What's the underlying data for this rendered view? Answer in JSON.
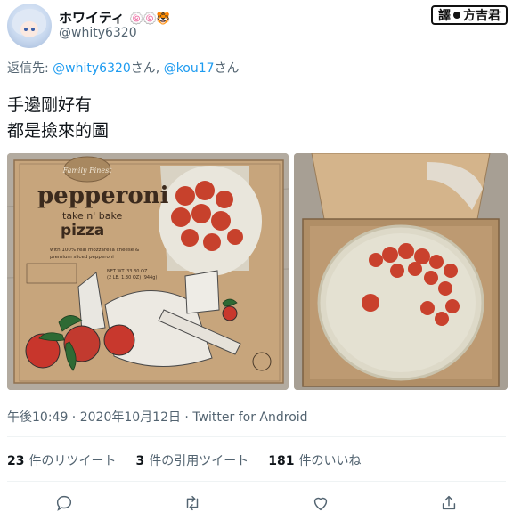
{
  "author": {
    "display_name": "ホワイティ",
    "name_emoji": "🍥🍥🐯",
    "handle": "@whity6320"
  },
  "badge": {
    "label_left": "譯",
    "label_right": "方吉君"
  },
  "reply": {
    "prefix": "返信先: ",
    "mention_1": "@whity6320",
    "san_1": "さん, ",
    "mention_2": "@kou17",
    "san_2": "さん"
  },
  "tweet": {
    "line_1": "手邊剛好有",
    "line_2": "都是撿來的圖"
  },
  "photos": {
    "box_brand": "Family Finest",
    "box_title": "pepperoni",
    "box_subtitle": "take n' bake",
    "box_product": "pizza",
    "box_desc_1": "with 100% real mozzarella cheese &",
    "box_desc_2": "premium sliced pepperoni",
    "box_weight_1": "NET WT. 33.30 OZ.",
    "box_weight_2": "(2 LB. 1.30 OZ) (944g)"
  },
  "meta": {
    "time": "午後10:49",
    "separator": " · ",
    "date": "2020年10月12日",
    "source": "Twitter for Android"
  },
  "stats": {
    "retweets_count": "23",
    "retweets_label": "件のリツイート",
    "quotes_count": "3",
    "quotes_label": "件の引用ツイート",
    "likes_count": "181",
    "likes_label": "件のいいね"
  },
  "colors": {
    "link": "#1d9bf0",
    "secondary_text": "#536471",
    "primary_text": "#0f1419"
  }
}
